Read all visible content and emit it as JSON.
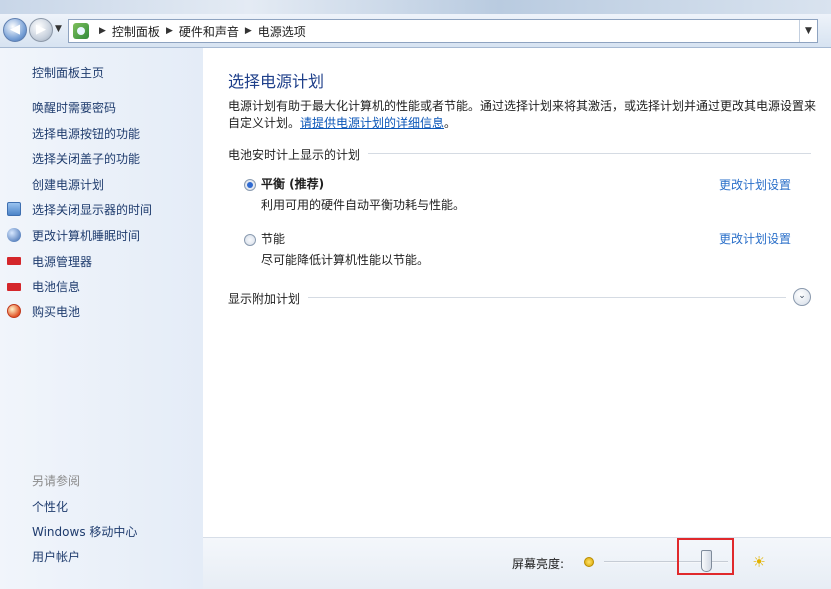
{
  "address_bar": {
    "crumbs": [
      "控制面板",
      "硬件和声音",
      "电源选项"
    ]
  },
  "left_pane": {
    "home": "控制面板主页",
    "links": [
      "唤醒时需要密码",
      "选择电源按钮的功能",
      "选择关闭盖子的功能",
      "创建电源计划",
      "选择关闭显示器的时间",
      "更改计算机睡眠时间",
      "电源管理器",
      "电池信息",
      "购买电池"
    ],
    "see_also": "另请参阅",
    "see_also_links": [
      "个性化",
      "Windows 移动中心",
      "用户帐户"
    ]
  },
  "main": {
    "title": "选择电源计划",
    "description": "电源计划有助于最大化计算机的性能或者节能。通过选择计划来将其激活，或选择计划并通过更改其电源设置来自定义计划。",
    "description_link": "请提供电源计划的详细信息",
    "description_end": "。",
    "group_label": "电池安时计上显示的计划",
    "plans": [
      {
        "name": "平衡 (推荐)",
        "description": "利用可用的硬件自动平衡功耗与性能。",
        "link": "更改计划设置",
        "selected": true
      },
      {
        "name": "节能",
        "description": "尽可能降低计算机性能以节能。",
        "link": "更改计划设置",
        "selected": false
      }
    ],
    "additional_plans": "显示附加计划"
  },
  "bottom": {
    "brightness_label": "屏幕亮度:",
    "brightness_level": 0.82
  }
}
